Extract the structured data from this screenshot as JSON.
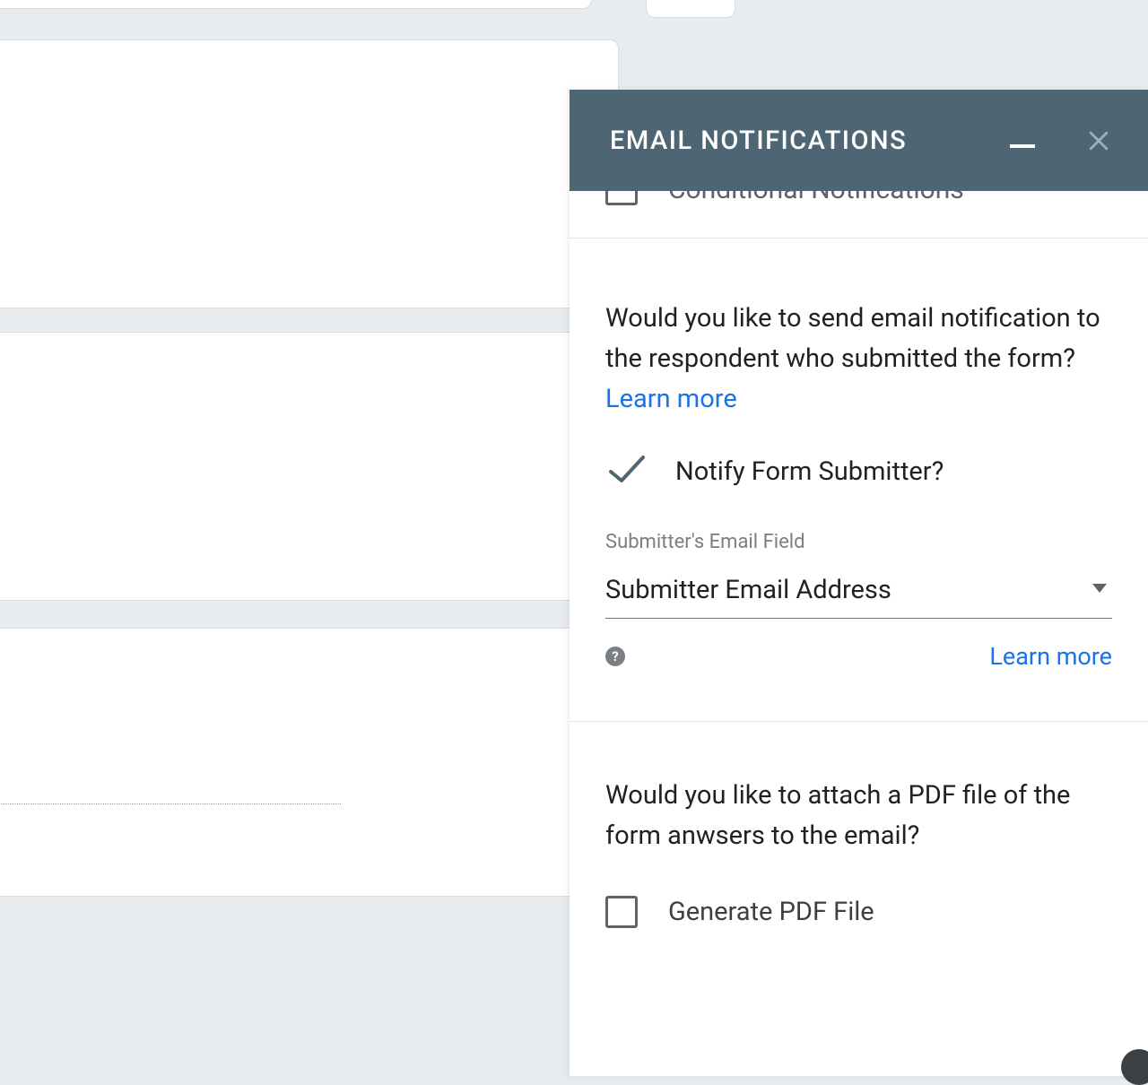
{
  "panel": {
    "title": "EMAIL NOTIFICATIONS",
    "conditional_label": "Conditional Notifications",
    "section_notify": {
      "intro_text": "Would you like to send email notification to the respondent who submitted the form? ",
      "learn_more": "Learn more",
      "check_label": "Notify Form Submitter?",
      "field_label": "Submitter's Email Field",
      "select_value": "Submitter Email Address",
      "help_char": "?",
      "learn_more_right": "Learn more"
    },
    "section_pdf": {
      "intro_text": "Would you like to attach a PDF file of the form anwsers to the email?",
      "check_label": "Generate PDF File"
    }
  }
}
